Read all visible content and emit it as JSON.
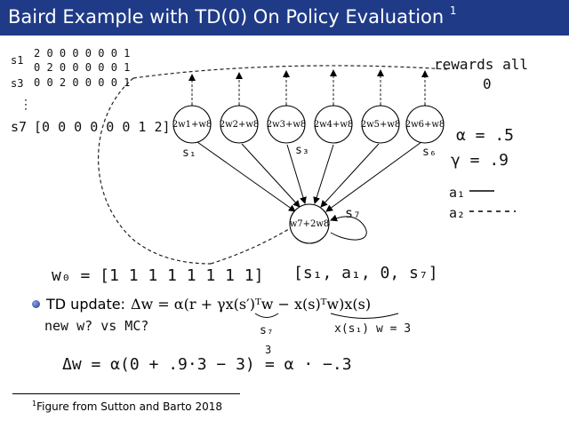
{
  "slide": {
    "title": "Baird Example with TD(0) On Policy Evaluation",
    "title_footnote_mark": "1",
    "colors": {
      "title_bar": "#1f3b87",
      "ink": "#000000"
    }
  },
  "nodes": {
    "n1": "2w1+w8",
    "n2": "2w2+w8",
    "n3": "2w3+w8",
    "n4": "2w4+w8",
    "n5": "2w5+w8",
    "n6": "2w6+w8",
    "n7": "w7+2w8"
  },
  "annotations": {
    "s1_feature_label": "s1",
    "s1_feature_row1": "2 0 0 0 0 0 0 1",
    "s1_feature_row2": "0 2 0 0 0 0 0 1",
    "s3_feature_label": "s3",
    "s3_feature_row": "0 0 2 0 0 0 0 1",
    "dots": "⋮",
    "s7_feature_label": "s7",
    "s7_feature_row": "[0 0 0 0 0 0 1 2]",
    "rewards_line1": "rewards all",
    "rewards_line2": "0",
    "alpha": "α = .5",
    "gamma": "γ = .9",
    "a1": "a₁",
    "a2": "a₂",
    "node1_state": "s₁",
    "node3_state": "s₃",
    "node6_state": "s₆",
    "node7_state": "s₇",
    "w0": "w₀ = [1 1 1 1 1 1 1 1]",
    "tuple": "[s₁, a₁, 0, s₇]",
    "new_w": "new w? vs MC?",
    "s7_under": "s₇",
    "xs_under": "x(s₁) w = 3",
    "three_small": "3",
    "delta_line": "Δw = α(0 + .9·3 − 3)",
    "delta_result": "= α · −.3"
  },
  "bullet": {
    "label": "TD update:",
    "equation": "Δw = α(r + γx(s′)ᵀw − x(s)ᵀw)x(s)"
  },
  "footnote": {
    "mark": "1",
    "text": "Figure from Sutton and Barto 2018"
  }
}
